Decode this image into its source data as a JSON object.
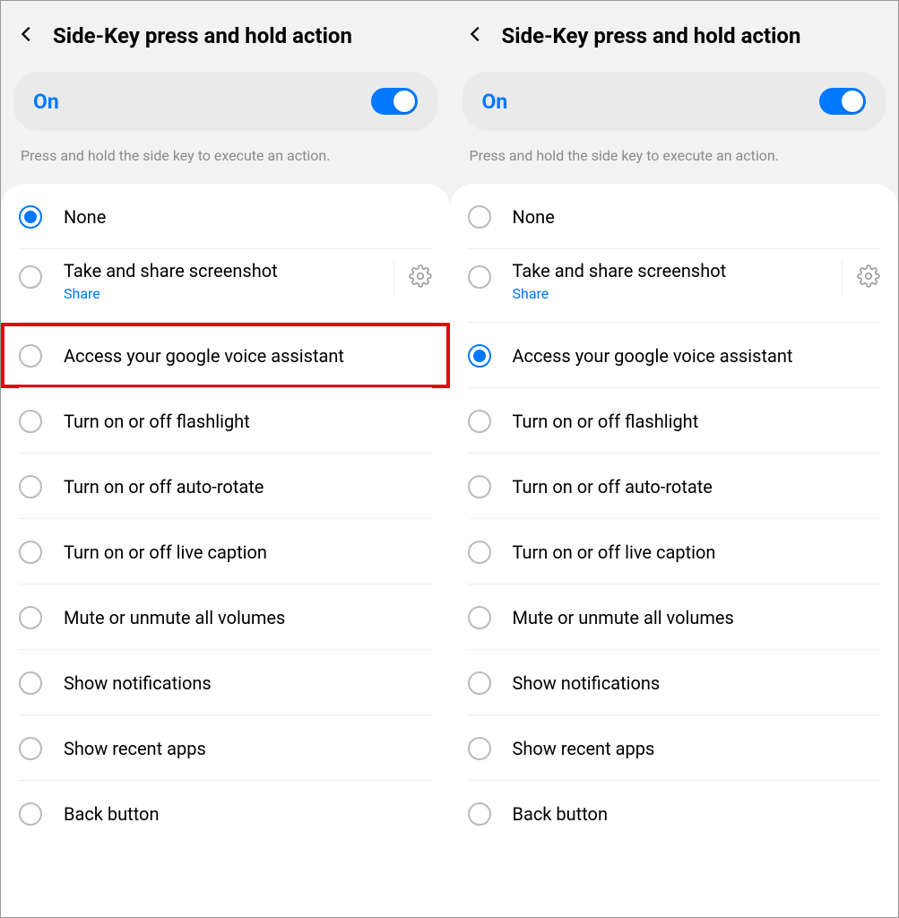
{
  "panes": [
    {
      "title": "Side-Key press and hold action",
      "toggle": {
        "label": "On",
        "state": true
      },
      "description": "Press and hold the side key to execute an action.",
      "selected_index": 0,
      "highlight_index": 2,
      "items": [
        {
          "label": "None"
        },
        {
          "label": "Take and share screenshot",
          "sub": "Share",
          "gear": true
        },
        {
          "label": "Access your google voice assistant"
        },
        {
          "label": "Turn on or off flashlight"
        },
        {
          "label": "Turn on or off auto-rotate"
        },
        {
          "label": "Turn on or off live caption"
        },
        {
          "label": "Mute or unmute all volumes"
        },
        {
          "label": "Show notifications"
        },
        {
          "label": "Show recent apps"
        },
        {
          "label": "Back button"
        }
      ]
    },
    {
      "title": "Side-Key press and hold action",
      "toggle": {
        "label": "On",
        "state": true
      },
      "description": "Press and hold the side key to execute an action.",
      "selected_index": 2,
      "highlight_index": null,
      "items": [
        {
          "label": "None"
        },
        {
          "label": "Take and share screenshot",
          "sub": "Share",
          "gear": true
        },
        {
          "label": "Access your google voice assistant"
        },
        {
          "label": "Turn on or off flashlight"
        },
        {
          "label": "Turn on or off auto-rotate"
        },
        {
          "label": "Turn on or off live caption"
        },
        {
          "label": "Mute or unmute all volumes"
        },
        {
          "label": "Show notifications"
        },
        {
          "label": "Show recent apps"
        },
        {
          "label": "Back button"
        }
      ]
    }
  ]
}
